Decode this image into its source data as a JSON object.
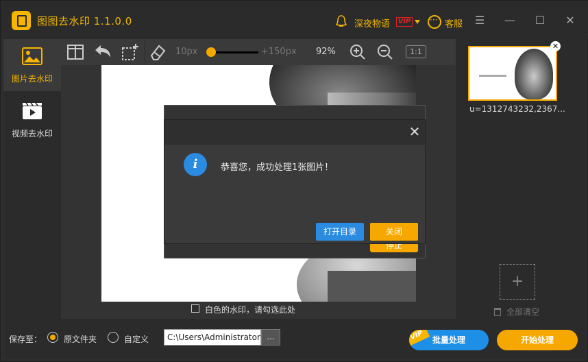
{
  "app": {
    "title": "图图去水印  1.1.0.0",
    "user_name": "深夜物语",
    "vip_label": "VIP",
    "service_label": "客服",
    "window_controls": [
      "menu-icon",
      "minimize-icon",
      "maximize-icon",
      "close-icon"
    ]
  },
  "sidebar": {
    "items": [
      {
        "label": "图片去水印",
        "icon": "image-icon",
        "active": true
      },
      {
        "label": "视频去水印",
        "icon": "video-icon",
        "active": false
      }
    ]
  },
  "toolbar": {
    "tools": [
      "split-view-icon",
      "undo-icon",
      "crop-icon",
      "eraser-icon"
    ],
    "brush_min": "10px",
    "brush_max": "+150px",
    "brush_level": 0.0,
    "zoom": "92%",
    "ratio_label": "1:1"
  },
  "canvas": {
    "white_watermark_label": "白色的水印，请勾选此处",
    "white_watermark_checked": false
  },
  "right_panel": {
    "thumbnail_name": "u=1312743232,2367...",
    "clear_all_label": "全部清空"
  },
  "bottom": {
    "save_to_label": "保存至：",
    "options": [
      {
        "label": "原文件夹",
        "selected": true
      },
      {
        "label": "自定义",
        "selected": false
      }
    ],
    "path_value": "C:\\Users\\Administrator",
    "browse_label": "...",
    "batch_label": "批量处理",
    "batch_vip_tag": "VIP",
    "start_label": "开始处理"
  },
  "dialog": {
    "message": "恭喜您，成功处理1张图片！",
    "open_dir_label": "打开目录",
    "close_label": "关闭",
    "behind_button_label": "停止"
  },
  "colors": {
    "accent": "#f7a800",
    "primary": "#2a8be0",
    "background": "#2e2e2e"
  }
}
